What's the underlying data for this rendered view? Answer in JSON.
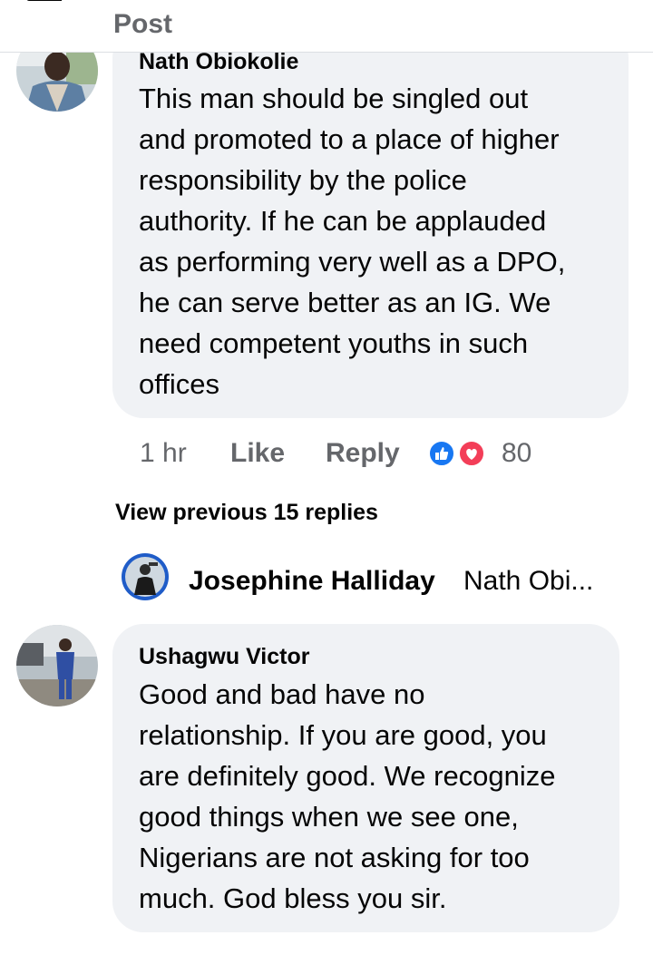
{
  "header": {
    "title": "Post"
  },
  "comments": [
    {
      "author": "Nath Obiokolie",
      "lines": [
        "This man should be singled out",
        "and promoted to a place of higher",
        "responsibility by the police",
        "authority. If he can be applauded",
        "as performing very well as a DPO,",
        "he can serve better as an IG. We",
        "need competent youths in such",
        "offices"
      ],
      "time": "1 hr",
      "like_label": "Like",
      "reply_label": "Reply",
      "reaction_count": "80",
      "reactions": [
        "like-icon",
        "love-icon"
      ]
    },
    {
      "author": "Ushagwu Victor",
      "lines": [
        "Good and bad have no",
        "relationship. If you are good, you",
        "are definitely good. We recognize",
        "good things when we see one,",
        "Nigerians are not asking for too",
        "much. God bless you sir."
      ]
    }
  ],
  "replies": {
    "view_previous": "View previous 15 replies",
    "latest": {
      "author": "Josephine Halliday",
      "preview": "Nath Obi..."
    }
  },
  "colors": {
    "bubble": "#f0f2f5",
    "secondary_text": "#65676b",
    "like_blue": "#1877f2",
    "love_red": "#f33e58"
  }
}
